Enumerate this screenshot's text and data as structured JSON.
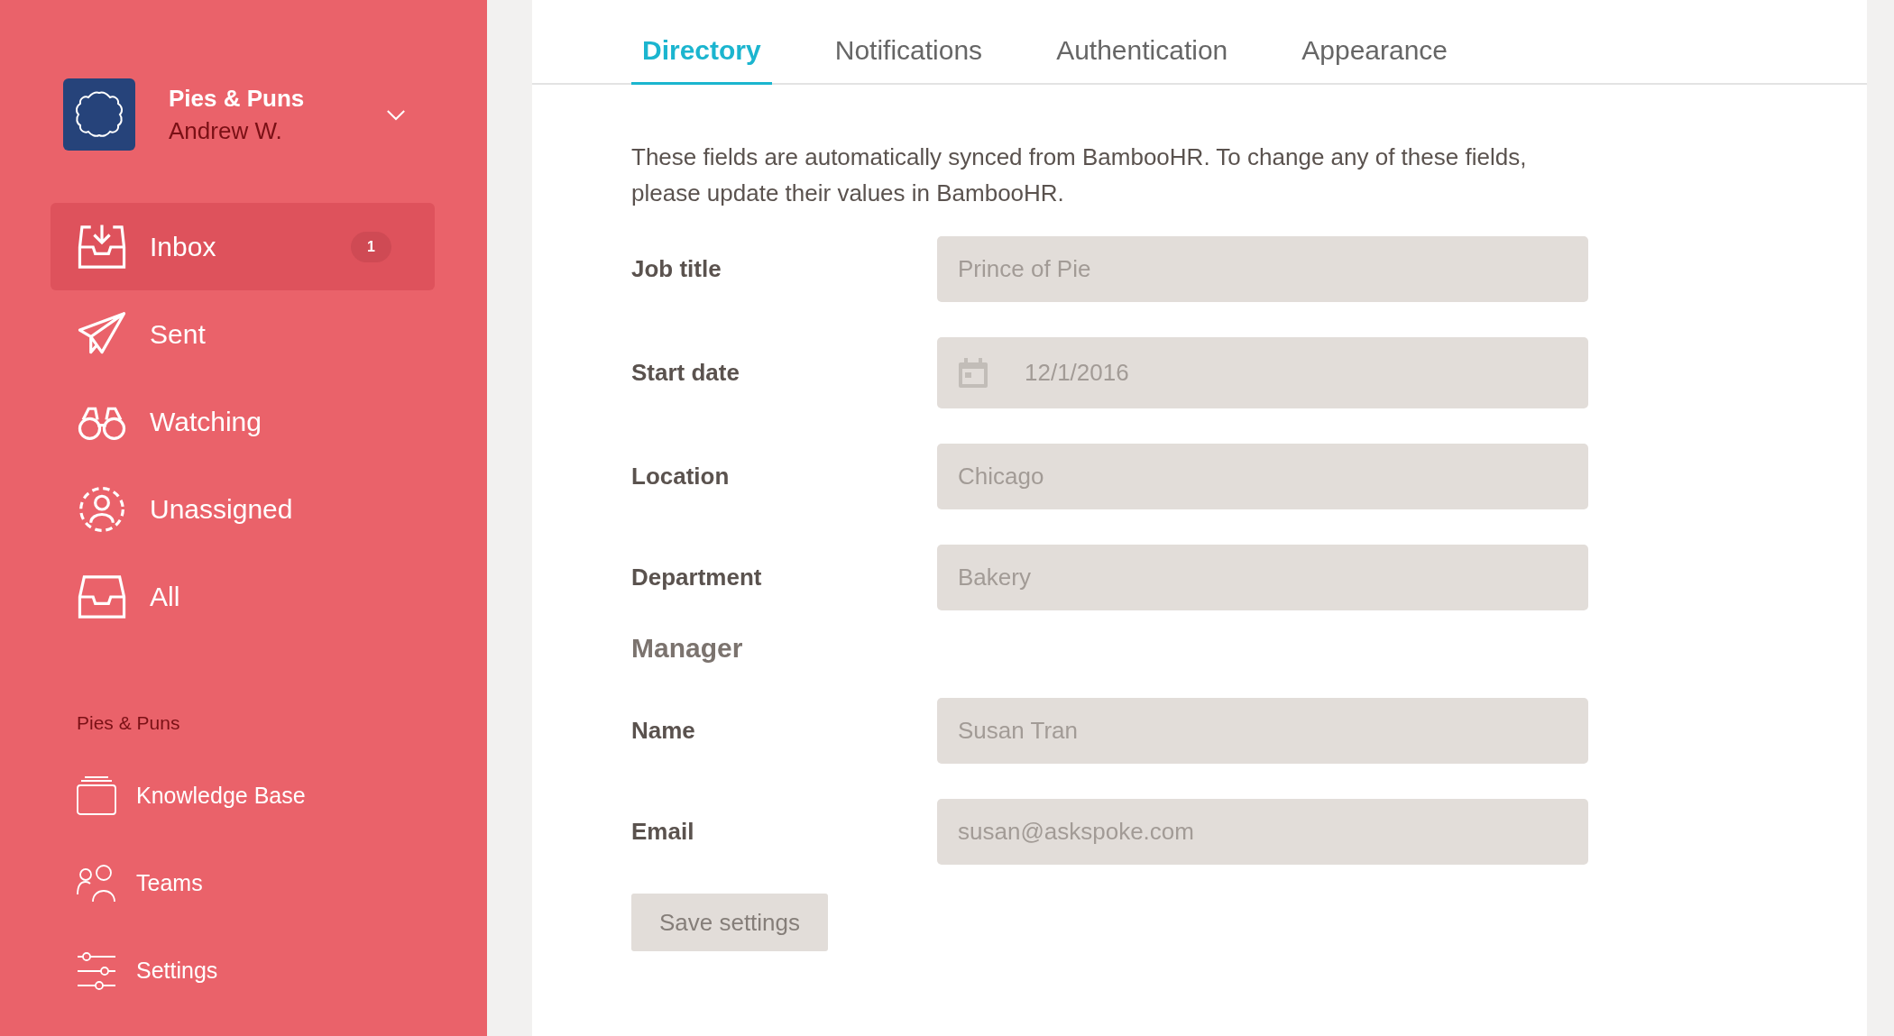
{
  "account": {
    "org": "Pies & Puns",
    "user": "Andrew W."
  },
  "nav": [
    {
      "label": "Inbox",
      "selected": true,
      "badge": "1"
    },
    {
      "label": "Sent",
      "selected": false
    },
    {
      "label": "Watching",
      "selected": false
    },
    {
      "label": "Unassigned",
      "selected": false
    },
    {
      "label": "All",
      "selected": false
    }
  ],
  "section": {
    "title": "Pies & Puns",
    "items": [
      {
        "label": "Knowledge Base",
        "selected": false
      },
      {
        "label": "Teams",
        "selected": false
      },
      {
        "label": "Settings",
        "selected": false
      }
    ]
  },
  "tabs": [
    {
      "label": "Directory",
      "selected": true
    },
    {
      "label": "Notifications",
      "selected": false
    },
    {
      "label": "Authentication",
      "selected": false
    },
    {
      "label": "Appearance",
      "selected": false
    }
  ],
  "intro": "These fields are automatically synced from BambooHR. To change any of these fields, please update their values in BambooHR.",
  "rows": [
    {
      "kind": "text",
      "label": "Job title",
      "value": "Prince of Pie"
    },
    {
      "kind": "date",
      "label": "Start date",
      "value": "12/1/2016"
    },
    {
      "kind": "text",
      "label": "Location",
      "value": "Chicago"
    },
    {
      "kind": "text",
      "label": "Department",
      "value": "Bakery"
    },
    {
      "kind": "heading",
      "label": "Manager"
    },
    {
      "kind": "text",
      "label": "Name",
      "value": "Susan Tran"
    },
    {
      "kind": "text",
      "label": "Email",
      "value": "susan@askspoke.com"
    }
  ],
  "save_button": "Save settings"
}
